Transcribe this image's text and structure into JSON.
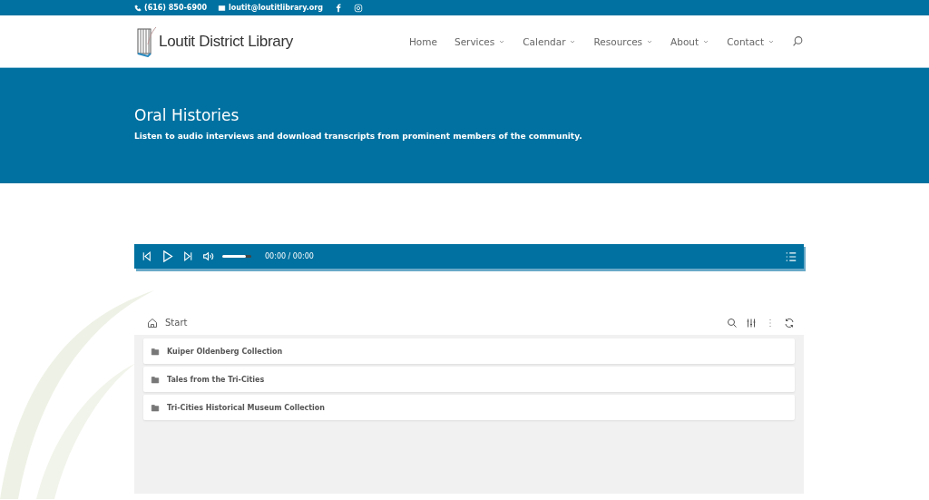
{
  "top_bar": {
    "phone": "(616) 850-6900",
    "email": "loutit@loutitlibrary.org"
  },
  "header": {
    "logo_text": "Loutit District Library",
    "nav": [
      {
        "label": "Home",
        "has_menu": false
      },
      {
        "label": "Services",
        "has_menu": true
      },
      {
        "label": "Calendar",
        "has_menu": true
      },
      {
        "label": "Resources",
        "has_menu": true
      },
      {
        "label": "About",
        "has_menu": true
      },
      {
        "label": "Contact",
        "has_menu": true
      }
    ]
  },
  "hero": {
    "title": "Oral Histories",
    "subtitle": "Listen to audio interviews and download transcripts from prominent members of the community."
  },
  "player": {
    "volume": {
      "level": 0.8
    },
    "time": "00:00 / 00:00"
  },
  "browser": {
    "breadcrumb": "Start",
    "folders": [
      {
        "name": "Kuiper Oldenberg Collection"
      },
      {
        "name": "Tales from the Tri-Cities"
      },
      {
        "name": "Tri-Cities Historical Museum Collection"
      }
    ]
  }
}
